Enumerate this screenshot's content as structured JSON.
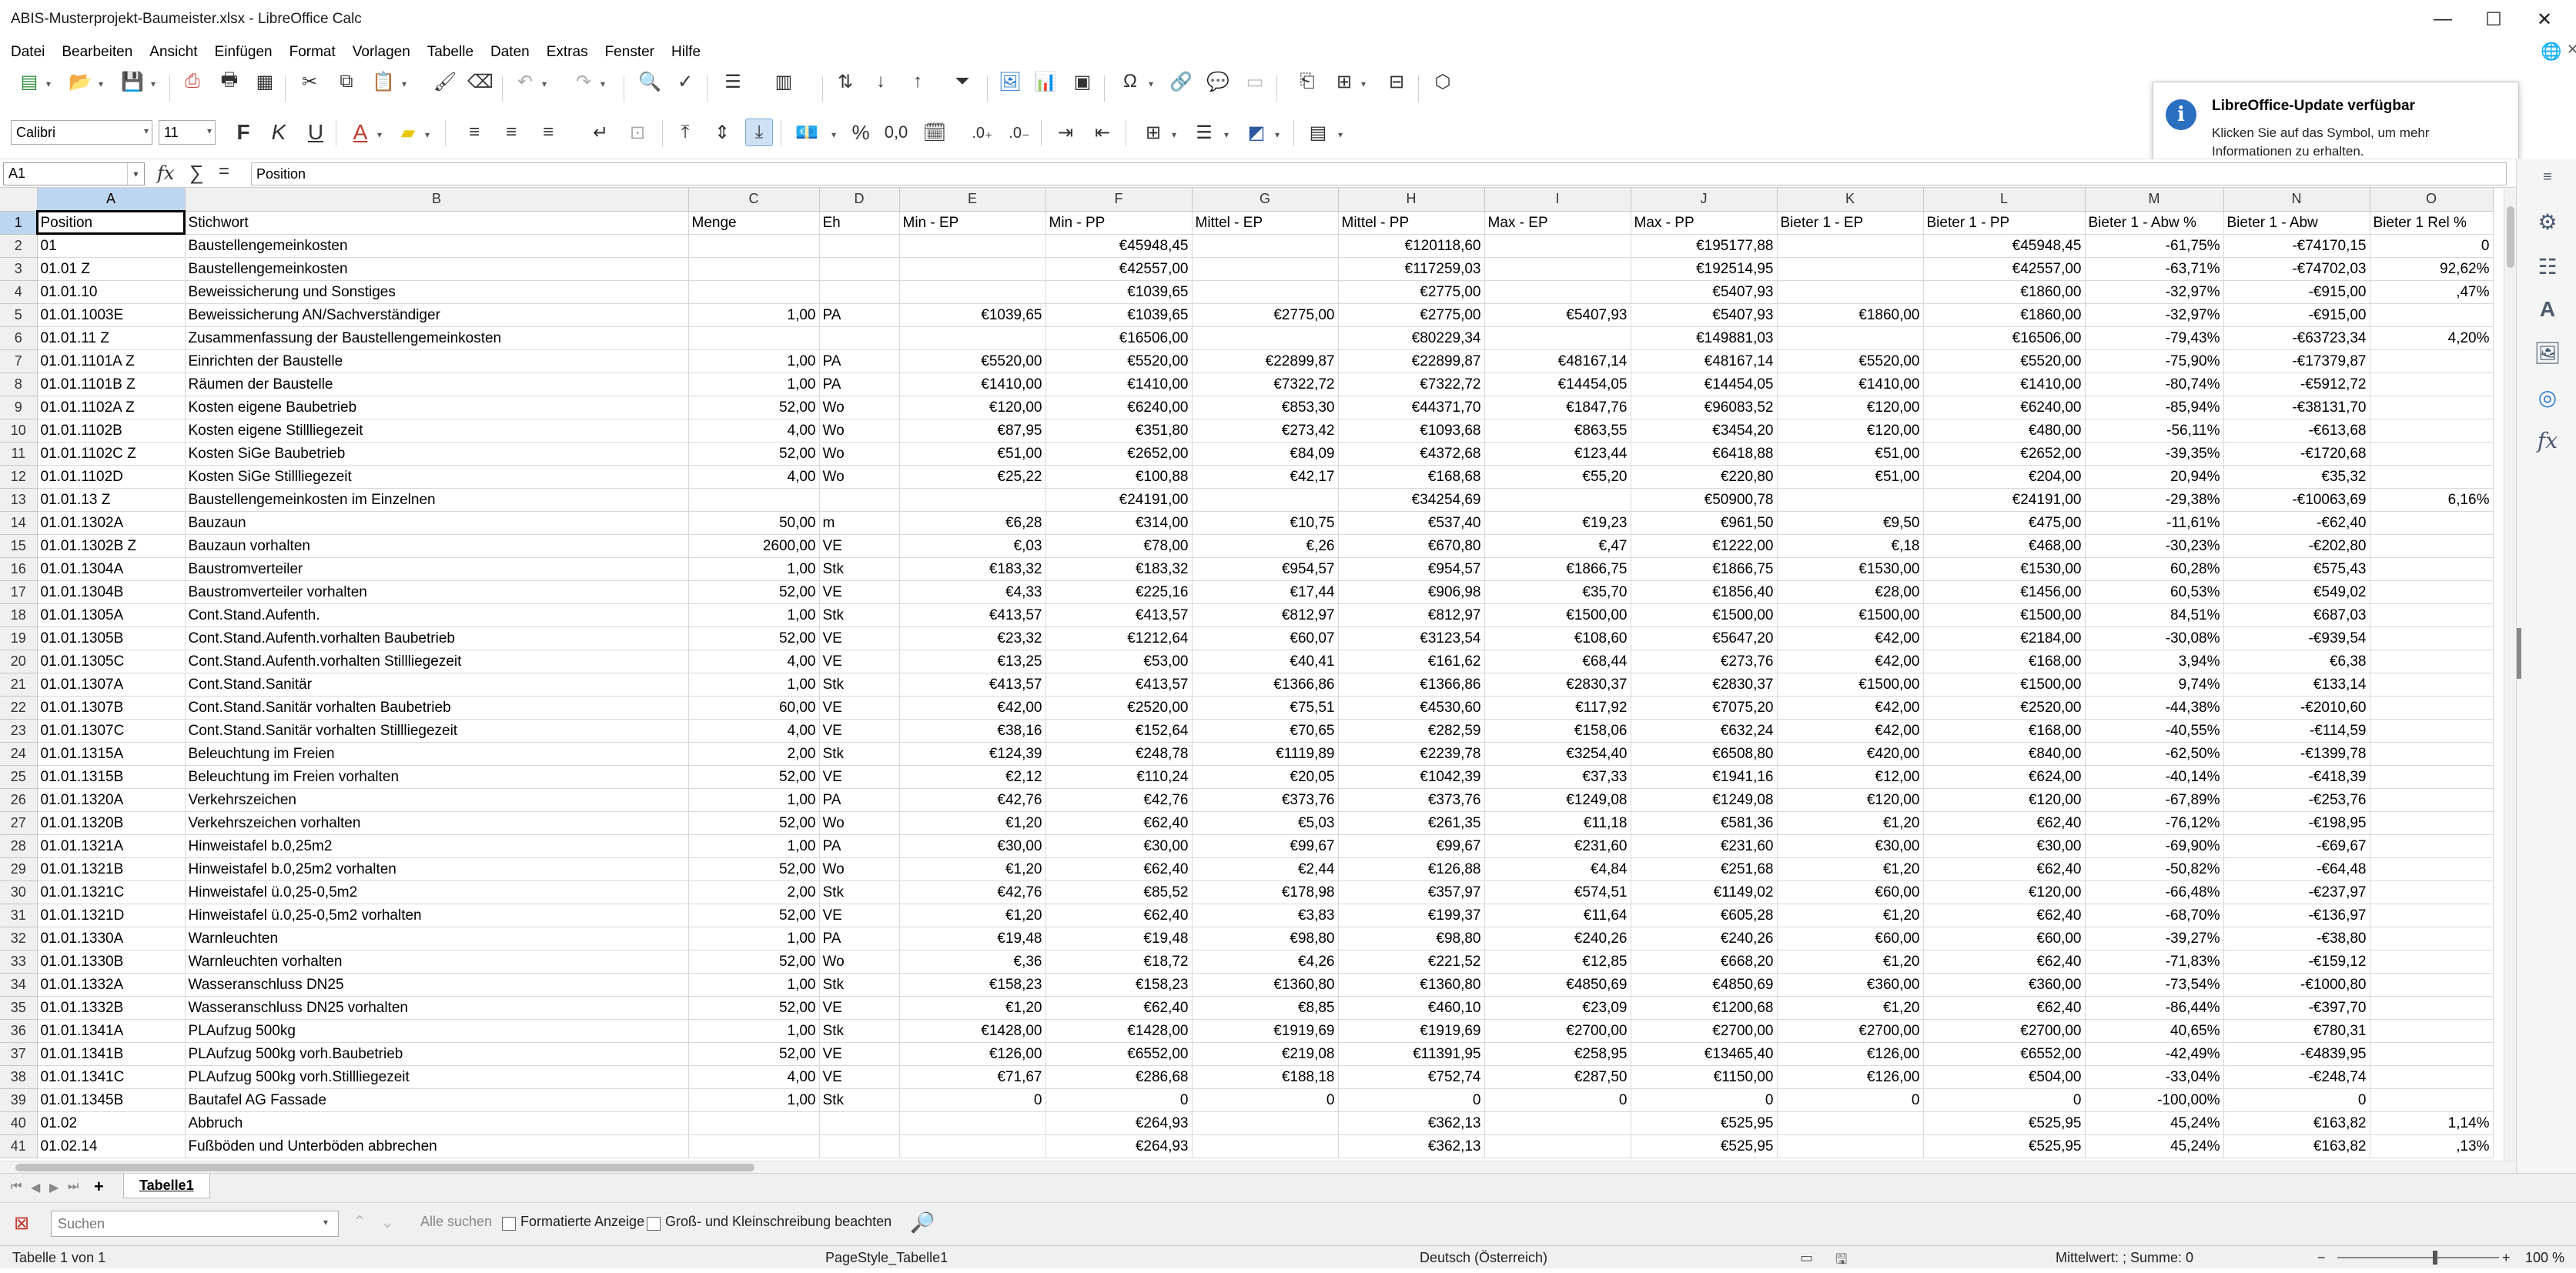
{
  "window": {
    "title": "ABIS-Musterprojekt-Baumeister.xlsx - LibreOffice Calc"
  },
  "menu": [
    "Datei",
    "Bearbeiten",
    "Ansicht",
    "Einfügen",
    "Format",
    "Vorlagen",
    "Tabelle",
    "Daten",
    "Extras",
    "Fenster",
    "Hilfe"
  ],
  "format_toolbar": {
    "font_name": "Calibri",
    "font_size": "11",
    "bold": "F",
    "italic": "K",
    "underline": "U",
    "percent": "%",
    "decimals": "0,0"
  },
  "notification": {
    "title": "LibreOffice-Update verfügbar",
    "body": "Klicken Sie auf das Symbol, um mehr Informationen zu erhalten."
  },
  "formula_bar": {
    "cell_ref": "A1",
    "content": "Position"
  },
  "columns": [
    "A",
    "B",
    "C",
    "D",
    "E",
    "F",
    "G",
    "H",
    "I",
    "J",
    "K",
    "L",
    "M",
    "N",
    "O"
  ],
  "rows": [
    [
      "1",
      "Position",
      "Stichwort",
      "Menge",
      "Eh",
      "Min - EP",
      "Min - PP",
      "Mittel - EP",
      "Mittel - PP",
      "Max - EP",
      "Max - PP",
      "Bieter 1 - EP",
      "Bieter 1 - PP",
      "Bieter 1 - Abw %",
      "Bieter 1 - Abw",
      "Bieter 1 Rel %"
    ],
    [
      "2",
      "01",
      "Baustellengemeinkosten",
      "",
      "",
      "",
      "€45948,45",
      "",
      "€120118,60",
      "",
      "€195177,88",
      "",
      "€45948,45",
      "-61,75%",
      "-€74170,15",
      "0"
    ],
    [
      "3",
      "01.01  Z",
      "Baustellengemeinkosten",
      "",
      "",
      "",
      "€42557,00",
      "",
      "€117259,03",
      "",
      "€192514,95",
      "",
      "€42557,00",
      "-63,71%",
      "-€74702,03",
      "92,62%"
    ],
    [
      "4",
      "01.01.10",
      "Beweissicherung und Sonstiges",
      "",
      "",
      "",
      "€1039,65",
      "",
      "€2775,00",
      "",
      "€5407,93",
      "",
      "€1860,00",
      "-32,97%",
      "-€915,00",
      ",47%"
    ],
    [
      "5",
      "01.01.1003E",
      "Beweissicherung AN/Sachverständiger",
      "1,00",
      "PA",
      "€1039,65",
      "€1039,65",
      "€2775,00",
      "€2775,00",
      "€5407,93",
      "€5407,93",
      "€1860,00",
      "€1860,00",
      "-32,97%",
      "-€915,00",
      ""
    ],
    [
      "6",
      "01.01.11  Z",
      "Zusammenfassung der Baustellengemeinkosten",
      "",
      "",
      "",
      "€16506,00",
      "",
      "€80229,34",
      "",
      "€149881,03",
      "",
      "€16506,00",
      "-79,43%",
      "-€63723,34",
      "4,20%"
    ],
    [
      "7",
      "01.01.1101A  Z",
      "Einrichten der Baustelle",
      "1,00",
      "PA",
      "€5520,00",
      "€5520,00",
      "€22899,87",
      "€22899,87",
      "€48167,14",
      "€48167,14",
      "€5520,00",
      "€5520,00",
      "-75,90%",
      "-€17379,87",
      ""
    ],
    [
      "8",
      "01.01.1101B  Z",
      "Räumen der Baustelle",
      "1,00",
      "PA",
      "€1410,00",
      "€1410,00",
      "€7322,72",
      "€7322,72",
      "€14454,05",
      "€14454,05",
      "€1410,00",
      "€1410,00",
      "-80,74%",
      "-€5912,72",
      ""
    ],
    [
      "9",
      "01.01.1102A  Z",
      "Kosten eigene Baubetrieb",
      "52,00",
      "Wo",
      "€120,00",
      "€6240,00",
      "€853,30",
      "€44371,70",
      "€1847,76",
      "€96083,52",
      "€120,00",
      "€6240,00",
      "-85,94%",
      "-€38131,70",
      ""
    ],
    [
      "10",
      "01.01.1102B",
      "Kosten eigene Stillliegezeit",
      "4,00",
      "Wo",
      "€87,95",
      "€351,80",
      "€273,42",
      "€1093,68",
      "€863,55",
      "€3454,20",
      "€120,00",
      "€480,00",
      "-56,11%",
      "-€613,68",
      ""
    ],
    [
      "11",
      "01.01.1102C  Z",
      "Kosten SiGe Baubetrieb",
      "52,00",
      "Wo",
      "€51,00",
      "€2652,00",
      "€84,09",
      "€4372,68",
      "€123,44",
      "€6418,88",
      "€51,00",
      "€2652,00",
      "-39,35%",
      "-€1720,68",
      ""
    ],
    [
      "12",
      "01.01.1102D",
      "Kosten SiGe Stillliegezeit",
      "4,00",
      "Wo",
      "€25,22",
      "€100,88",
      "€42,17",
      "€168,68",
      "€55,20",
      "€220,80",
      "€51,00",
      "€204,00",
      "20,94%",
      "€35,32",
      ""
    ],
    [
      "13",
      "01.01.13  Z",
      "Baustellengemeinkosten im Einzelnen",
      "",
      "",
      "",
      "€24191,00",
      "",
      "€34254,69",
      "",
      "€50900,78",
      "",
      "€24191,00",
      "-29,38%",
      "-€10063,69",
      "6,16%"
    ],
    [
      "14",
      "01.01.1302A",
      "Bauzaun",
      "50,00",
      "m",
      "€6,28",
      "€314,00",
      "€10,75",
      "€537,40",
      "€19,23",
      "€961,50",
      "€9,50",
      "€475,00",
      "-11,61%",
      "-€62,40",
      ""
    ],
    [
      "15",
      "01.01.1302B  Z",
      "Bauzaun vorhalten",
      "2600,00",
      "VE",
      "€,03",
      "€78,00",
      "€,26",
      "€670,80",
      "€,47",
      "€1222,00",
      "€,18",
      "€468,00",
      "-30,23%",
      "-€202,80",
      ""
    ],
    [
      "16",
      "01.01.1304A",
      "Baustromverteiler",
      "1,00",
      "Stk",
      "€183,32",
      "€183,32",
      "€954,57",
      "€954,57",
      "€1866,75",
      "€1866,75",
      "€1530,00",
      "€1530,00",
      "60,28%",
      "€575,43",
      ""
    ],
    [
      "17",
      "01.01.1304B",
      "Baustromverteiler vorhalten",
      "52,00",
      "VE",
      "€4,33",
      "€225,16",
      "€17,44",
      "€906,98",
      "€35,70",
      "€1856,40",
      "€28,00",
      "€1456,00",
      "60,53%",
      "€549,02",
      ""
    ],
    [
      "18",
      "01.01.1305A",
      "Cont.Stand.Aufenth.",
      "1,00",
      "Stk",
      "€413,57",
      "€413,57",
      "€812,97",
      "€812,97",
      "€1500,00",
      "€1500,00",
      "€1500,00",
      "€1500,00",
      "84,51%",
      "€687,03",
      ""
    ],
    [
      "19",
      "01.01.1305B",
      "Cont.Stand.Aufenth.vorhalten Baubetrieb",
      "52,00",
      "VE",
      "€23,32",
      "€1212,64",
      "€60,07",
      "€3123,54",
      "€108,60",
      "€5647,20",
      "€42,00",
      "€2184,00",
      "-30,08%",
      "-€939,54",
      ""
    ],
    [
      "20",
      "01.01.1305C",
      "Cont.Stand.Aufenth.vorhalten Stillliegezeit",
      "4,00",
      "VE",
      "€13,25",
      "€53,00",
      "€40,41",
      "€161,62",
      "€68,44",
      "€273,76",
      "€42,00",
      "€168,00",
      "3,94%",
      "€6,38",
      ""
    ],
    [
      "21",
      "01.01.1307A",
      "Cont.Stand.Sanitär",
      "1,00",
      "Stk",
      "€413,57",
      "€413,57",
      "€1366,86",
      "€1366,86",
      "€2830,37",
      "€2830,37",
      "€1500,00",
      "€1500,00",
      "9,74%",
      "€133,14",
      ""
    ],
    [
      "22",
      "01.01.1307B",
      "Cont.Stand.Sanitär vorhalten Baubetrieb",
      "60,00",
      "VE",
      "€42,00",
      "€2520,00",
      "€75,51",
      "€4530,60",
      "€117,92",
      "€7075,20",
      "€42,00",
      "€2520,00",
      "-44,38%",
      "-€2010,60",
      ""
    ],
    [
      "23",
      "01.01.1307C",
      "Cont.Stand.Sanitär vorhalten Stillliegezeit",
      "4,00",
      "VE",
      "€38,16",
      "€152,64",
      "€70,65",
      "€282,59",
      "€158,06",
      "€632,24",
      "€42,00",
      "€168,00",
      "-40,55%",
      "-€114,59",
      ""
    ],
    [
      "24",
      "01.01.1315A",
      "Beleuchtung im Freien",
      "2,00",
      "Stk",
      "€124,39",
      "€248,78",
      "€1119,89",
      "€2239,78",
      "€3254,40",
      "€6508,80",
      "€420,00",
      "€840,00",
      "-62,50%",
      "-€1399,78",
      ""
    ],
    [
      "25",
      "01.01.1315B",
      "Beleuchtung im Freien vorhalten",
      "52,00",
      "VE",
      "€2,12",
      "€110,24",
      "€20,05",
      "€1042,39",
      "€37,33",
      "€1941,16",
      "€12,00",
      "€624,00",
      "-40,14%",
      "-€418,39",
      ""
    ],
    [
      "26",
      "01.01.1320A",
      "Verkehrszeichen",
      "1,00",
      "PA",
      "€42,76",
      "€42,76",
      "€373,76",
      "€373,76",
      "€1249,08",
      "€1249,08",
      "€120,00",
      "€120,00",
      "-67,89%",
      "-€253,76",
      ""
    ],
    [
      "27",
      "01.01.1320B",
      "Verkehrszeichen vorhalten",
      "52,00",
      "Wo",
      "€1,20",
      "€62,40",
      "€5,03",
      "€261,35",
      "€11,18",
      "€581,36",
      "€1,20",
      "€62,40",
      "-76,12%",
      "-€198,95",
      ""
    ],
    [
      "28",
      "01.01.1321A",
      "Hinweistafel b.0,25m2",
      "1,00",
      "PA",
      "€30,00",
      "€30,00",
      "€99,67",
      "€99,67",
      "€231,60",
      "€231,60",
      "€30,00",
      "€30,00",
      "-69,90%",
      "-€69,67",
      ""
    ],
    [
      "29",
      "01.01.1321B",
      "Hinweistafel b.0,25m2 vorhalten",
      "52,00",
      "Wo",
      "€1,20",
      "€62,40",
      "€2,44",
      "€126,88",
      "€4,84",
      "€251,68",
      "€1,20",
      "€62,40",
      "-50,82%",
      "-€64,48",
      ""
    ],
    [
      "30",
      "01.01.1321C",
      "Hinweistafel ü.0,25-0,5m2",
      "2,00",
      "Stk",
      "€42,76",
      "€85,52",
      "€178,98",
      "€357,97",
      "€574,51",
      "€1149,02",
      "€60,00",
      "€120,00",
      "-66,48%",
      "-€237,97",
      ""
    ],
    [
      "31",
      "01.01.1321D",
      "Hinweistafel ü.0,25-0,5m2 vorhalten",
      "52,00",
      "VE",
      "€1,20",
      "€62,40",
      "€3,83",
      "€199,37",
      "€11,64",
      "€605,28",
      "€1,20",
      "€62,40",
      "-68,70%",
      "-€136,97",
      ""
    ],
    [
      "32",
      "01.01.1330A",
      "Warnleuchten",
      "1,00",
      "PA",
      "€19,48",
      "€19,48",
      "€98,80",
      "€98,80",
      "€240,26",
      "€240,26",
      "€60,00",
      "€60,00",
      "-39,27%",
      "-€38,80",
      ""
    ],
    [
      "33",
      "01.01.1330B",
      "Warnleuchten vorhalten",
      "52,00",
      "Wo",
      "€,36",
      "€18,72",
      "€4,26",
      "€221,52",
      "€12,85",
      "€668,20",
      "€1,20",
      "€62,40",
      "-71,83%",
      "-€159,12",
      ""
    ],
    [
      "34",
      "01.01.1332A",
      "Wasseranschluss DN25",
      "1,00",
      "Stk",
      "€158,23",
      "€158,23",
      "€1360,80",
      "€1360,80",
      "€4850,69",
      "€4850,69",
      "€360,00",
      "€360,00",
      "-73,54%",
      "-€1000,80",
      ""
    ],
    [
      "35",
      "01.01.1332B",
      "Wasseranschluss DN25 vorhalten",
      "52,00",
      "VE",
      "€1,20",
      "€62,40",
      "€8,85",
      "€460,10",
      "€23,09",
      "€1200,68",
      "€1,20",
      "€62,40",
      "-86,44%",
      "-€397,70",
      ""
    ],
    [
      "36",
      "01.01.1341A",
      "PLAufzug 500kg",
      "1,00",
      "Stk",
      "€1428,00",
      "€1428,00",
      "€1919,69",
      "€1919,69",
      "€2700,00",
      "€2700,00",
      "€2700,00",
      "€2700,00",
      "40,65%",
      "€780,31",
      ""
    ],
    [
      "37",
      "01.01.1341B",
      "PLAufzug 500kg vorh.Baubetrieb",
      "52,00",
      "VE",
      "€126,00",
      "€6552,00",
      "€219,08",
      "€11391,95",
      "€258,95",
      "€13465,40",
      "€126,00",
      "€6552,00",
      "-42,49%",
      "-€4839,95",
      ""
    ],
    [
      "38",
      "01.01.1341C",
      "PLAufzug 500kg vorh.Stillliegezeit",
      "4,00",
      "VE",
      "€71,67",
      "€286,68",
      "€188,18",
      "€752,74",
      "€287,50",
      "€1150,00",
      "€126,00",
      "€504,00",
      "-33,04%",
      "-€248,74",
      ""
    ],
    [
      "39",
      "01.01.1345B",
      "Bautafel AG Fassade",
      "1,00",
      "Stk",
      "0",
      "0",
      "0",
      "0",
      "0",
      "0",
      "0",
      "0",
      "-100,00%",
      "0",
      ""
    ],
    [
      "40",
      "01.02",
      "Abbruch",
      "",
      "",
      "",
      "€264,93",
      "",
      "€362,13",
      "",
      "€525,95",
      "",
      "€525,95",
      "45,24%",
      "€163,82",
      "1,14%"
    ],
    [
      "41",
      "01.02.14",
      "Fußböden und Unterböden abbrechen",
      "",
      "",
      "",
      "€264,93",
      "",
      "€362,13",
      "",
      "€525,95",
      "",
      "€525,95",
      "45,24%",
      "€163,82",
      ",13%"
    ]
  ],
  "sheet_tabs": {
    "add": "+",
    "active": "Tabelle1"
  },
  "find_bar": {
    "placeholder": "Suchen",
    "find_all": "Alle suchen",
    "formatted": "Formatierte Anzeige",
    "match_case": "Groß- und Kleinschreibung beachten"
  },
  "status_bar": {
    "sheet": "Tabelle 1 von 1",
    "page_style": "PageStyle_Tabelle1",
    "language": "Deutsch (Österreich)",
    "summary": "Mittelwert: ; Summe: 0",
    "zoom": "100 %"
  }
}
